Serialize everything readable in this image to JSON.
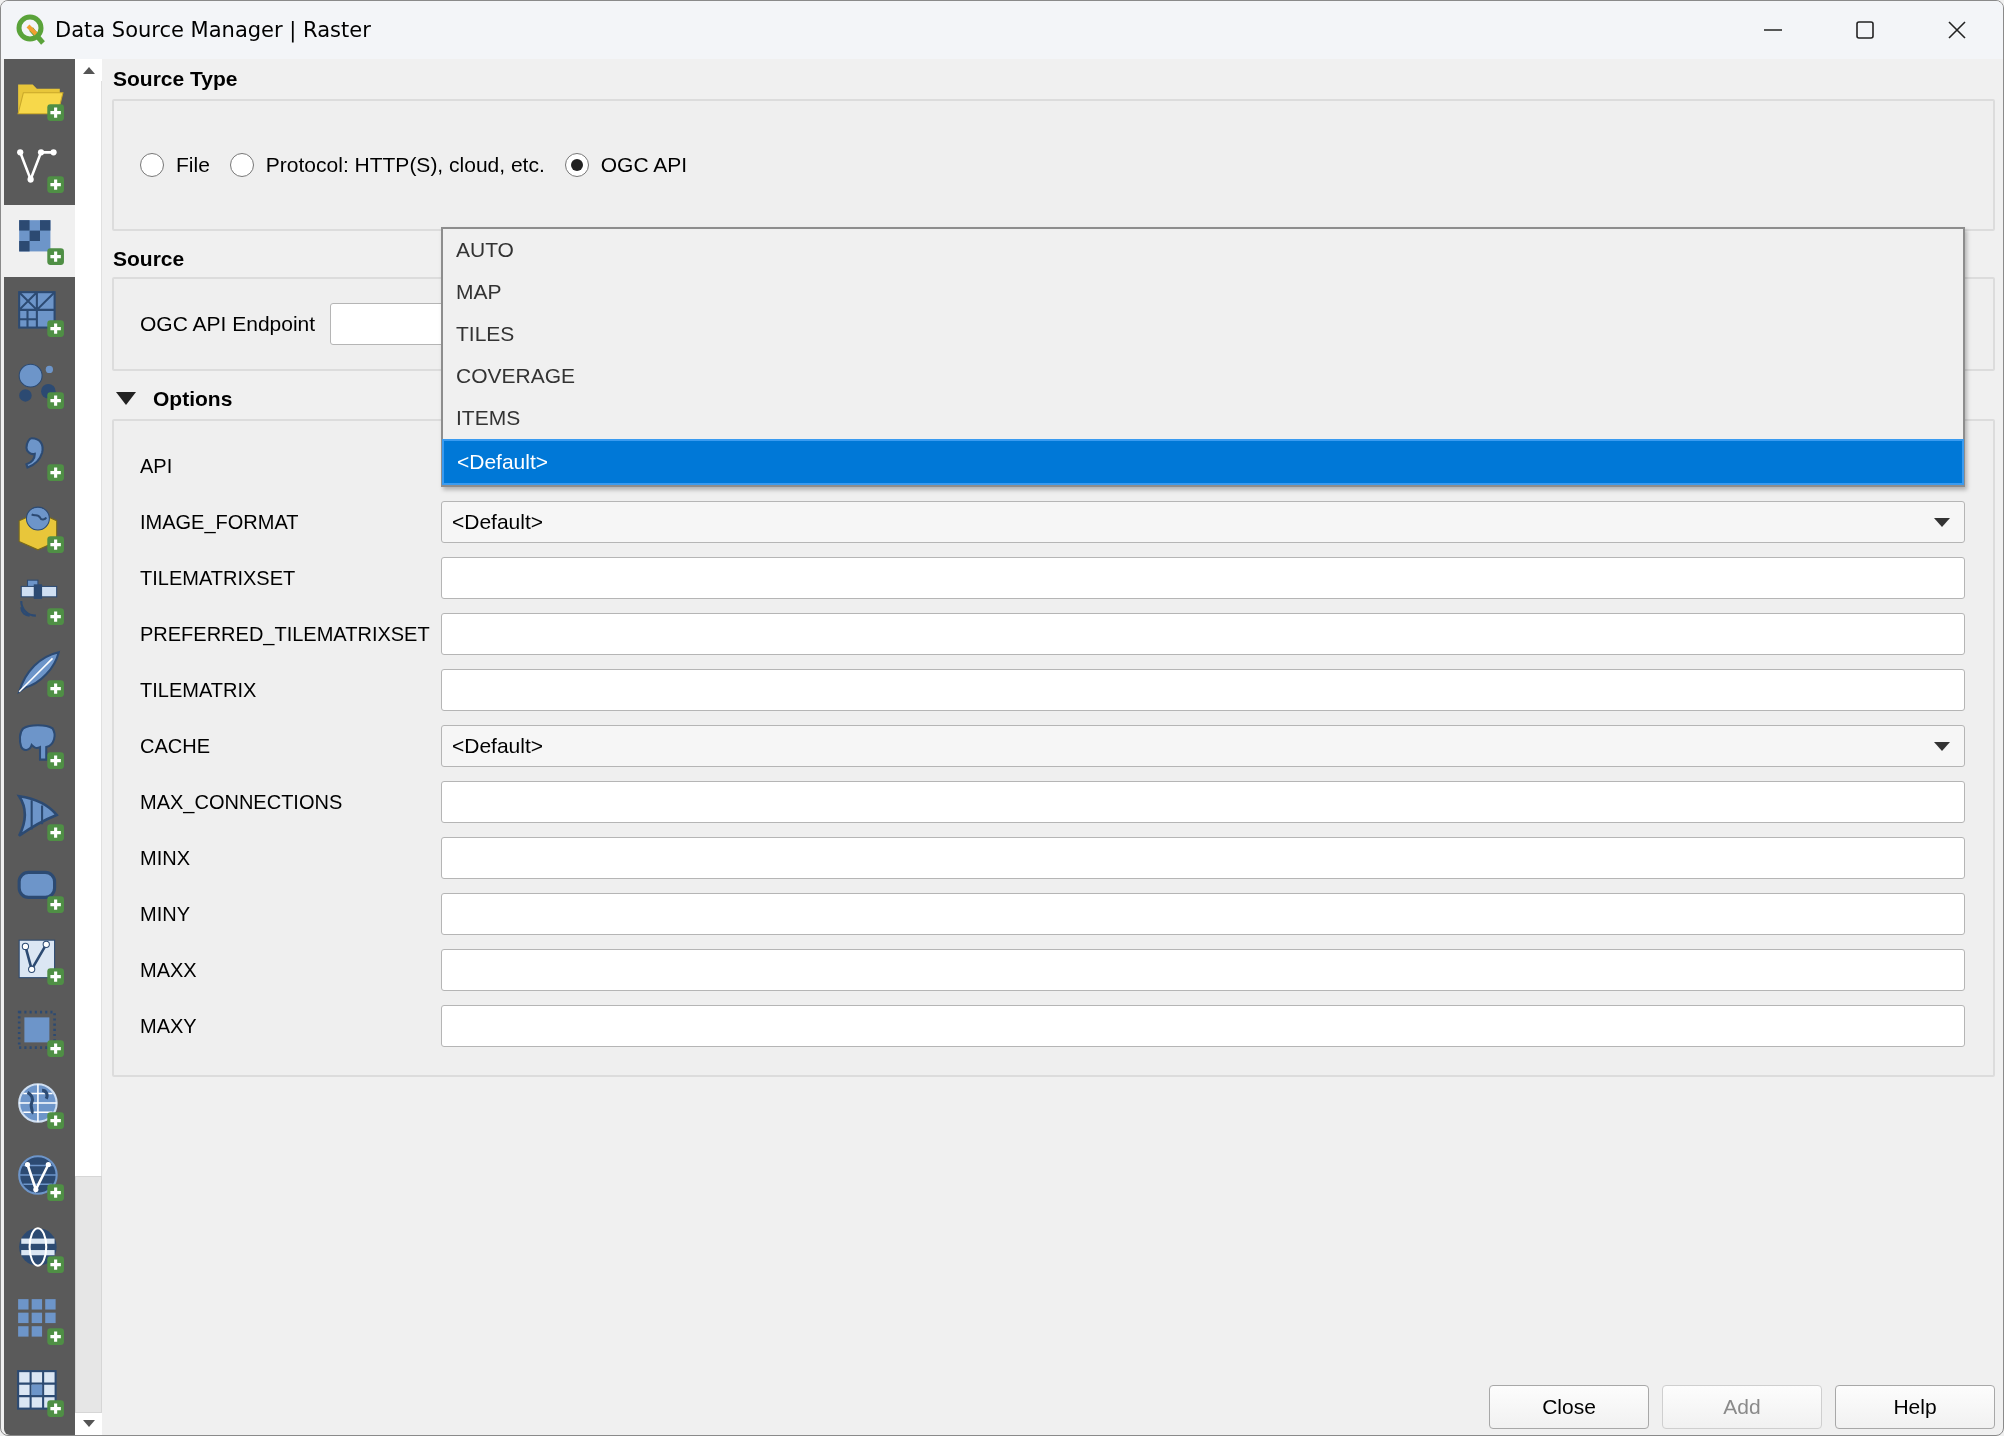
{
  "window": {
    "title": "Data Source Manager | Raster"
  },
  "sidebar": {
    "items": [
      {
        "kind": "folder",
        "selected": false
      },
      {
        "kind": "vertex-line",
        "selected": false
      },
      {
        "kind": "checker",
        "selected": true
      },
      {
        "kind": "mesh",
        "selected": false
      },
      {
        "kind": "dots",
        "selected": false
      },
      {
        "kind": "comma",
        "selected": false
      },
      {
        "kind": "globe-box",
        "selected": false
      },
      {
        "kind": "satellite",
        "selected": false
      },
      {
        "kind": "feather",
        "selected": false
      },
      {
        "kind": "elephant",
        "selected": false
      },
      {
        "kind": "sail",
        "selected": false
      },
      {
        "kind": "rounded-rect",
        "selected": false
      },
      {
        "kind": "vertex-card",
        "selected": false
      },
      {
        "kind": "dotted-square",
        "selected": false
      },
      {
        "kind": "globe",
        "selected": false
      },
      {
        "kind": "globe-vertex",
        "selected": false
      },
      {
        "kind": "striped-globe",
        "selected": false
      },
      {
        "kind": "tile-grid",
        "selected": false
      },
      {
        "kind": "table-grid",
        "selected": false
      }
    ]
  },
  "source_type": {
    "title": "Source Type",
    "options": [
      {
        "label": "File",
        "selected": false
      },
      {
        "label": "Protocol: HTTP(S), cloud, etc.",
        "selected": false
      },
      {
        "label": "OGC API",
        "selected": true
      }
    ]
  },
  "source": {
    "title": "Source",
    "endpoint_label": "OGC API Endpoint"
  },
  "options": {
    "title": "Options",
    "expanded": true,
    "rows": [
      {
        "label": "API",
        "kind": "combo",
        "open": true,
        "items": [
          {
            "label": "AUTO",
            "selected": false
          },
          {
            "label": "MAP",
            "selected": false
          },
          {
            "label": "TILES",
            "selected": false
          },
          {
            "label": "COVERAGE",
            "selected": false
          },
          {
            "label": "ITEMS",
            "selected": false
          },
          {
            "label": "<Default>",
            "selected": true
          }
        ]
      },
      {
        "label": "IMAGE_FORMAT",
        "kind": "combo",
        "value": "<Default>"
      },
      {
        "label": "TILEMATRIXSET",
        "kind": "text"
      },
      {
        "label": "PREFERRED_TILEMATRIXSET",
        "kind": "text"
      },
      {
        "label": "TILEMATRIX",
        "kind": "text"
      },
      {
        "label": "CACHE",
        "kind": "combo",
        "value": "<Default>"
      },
      {
        "label": "MAX_CONNECTIONS",
        "kind": "text"
      },
      {
        "label": "MINX",
        "kind": "text"
      },
      {
        "label": "MINY",
        "kind": "text"
      },
      {
        "label": "MAXX",
        "kind": "text"
      },
      {
        "label": "MAXY",
        "kind": "text"
      }
    ]
  },
  "buttons": [
    {
      "label": "Close",
      "disabled": false
    },
    {
      "label": "Add",
      "disabled": true
    },
    {
      "label": "Help",
      "disabled": false
    }
  ]
}
